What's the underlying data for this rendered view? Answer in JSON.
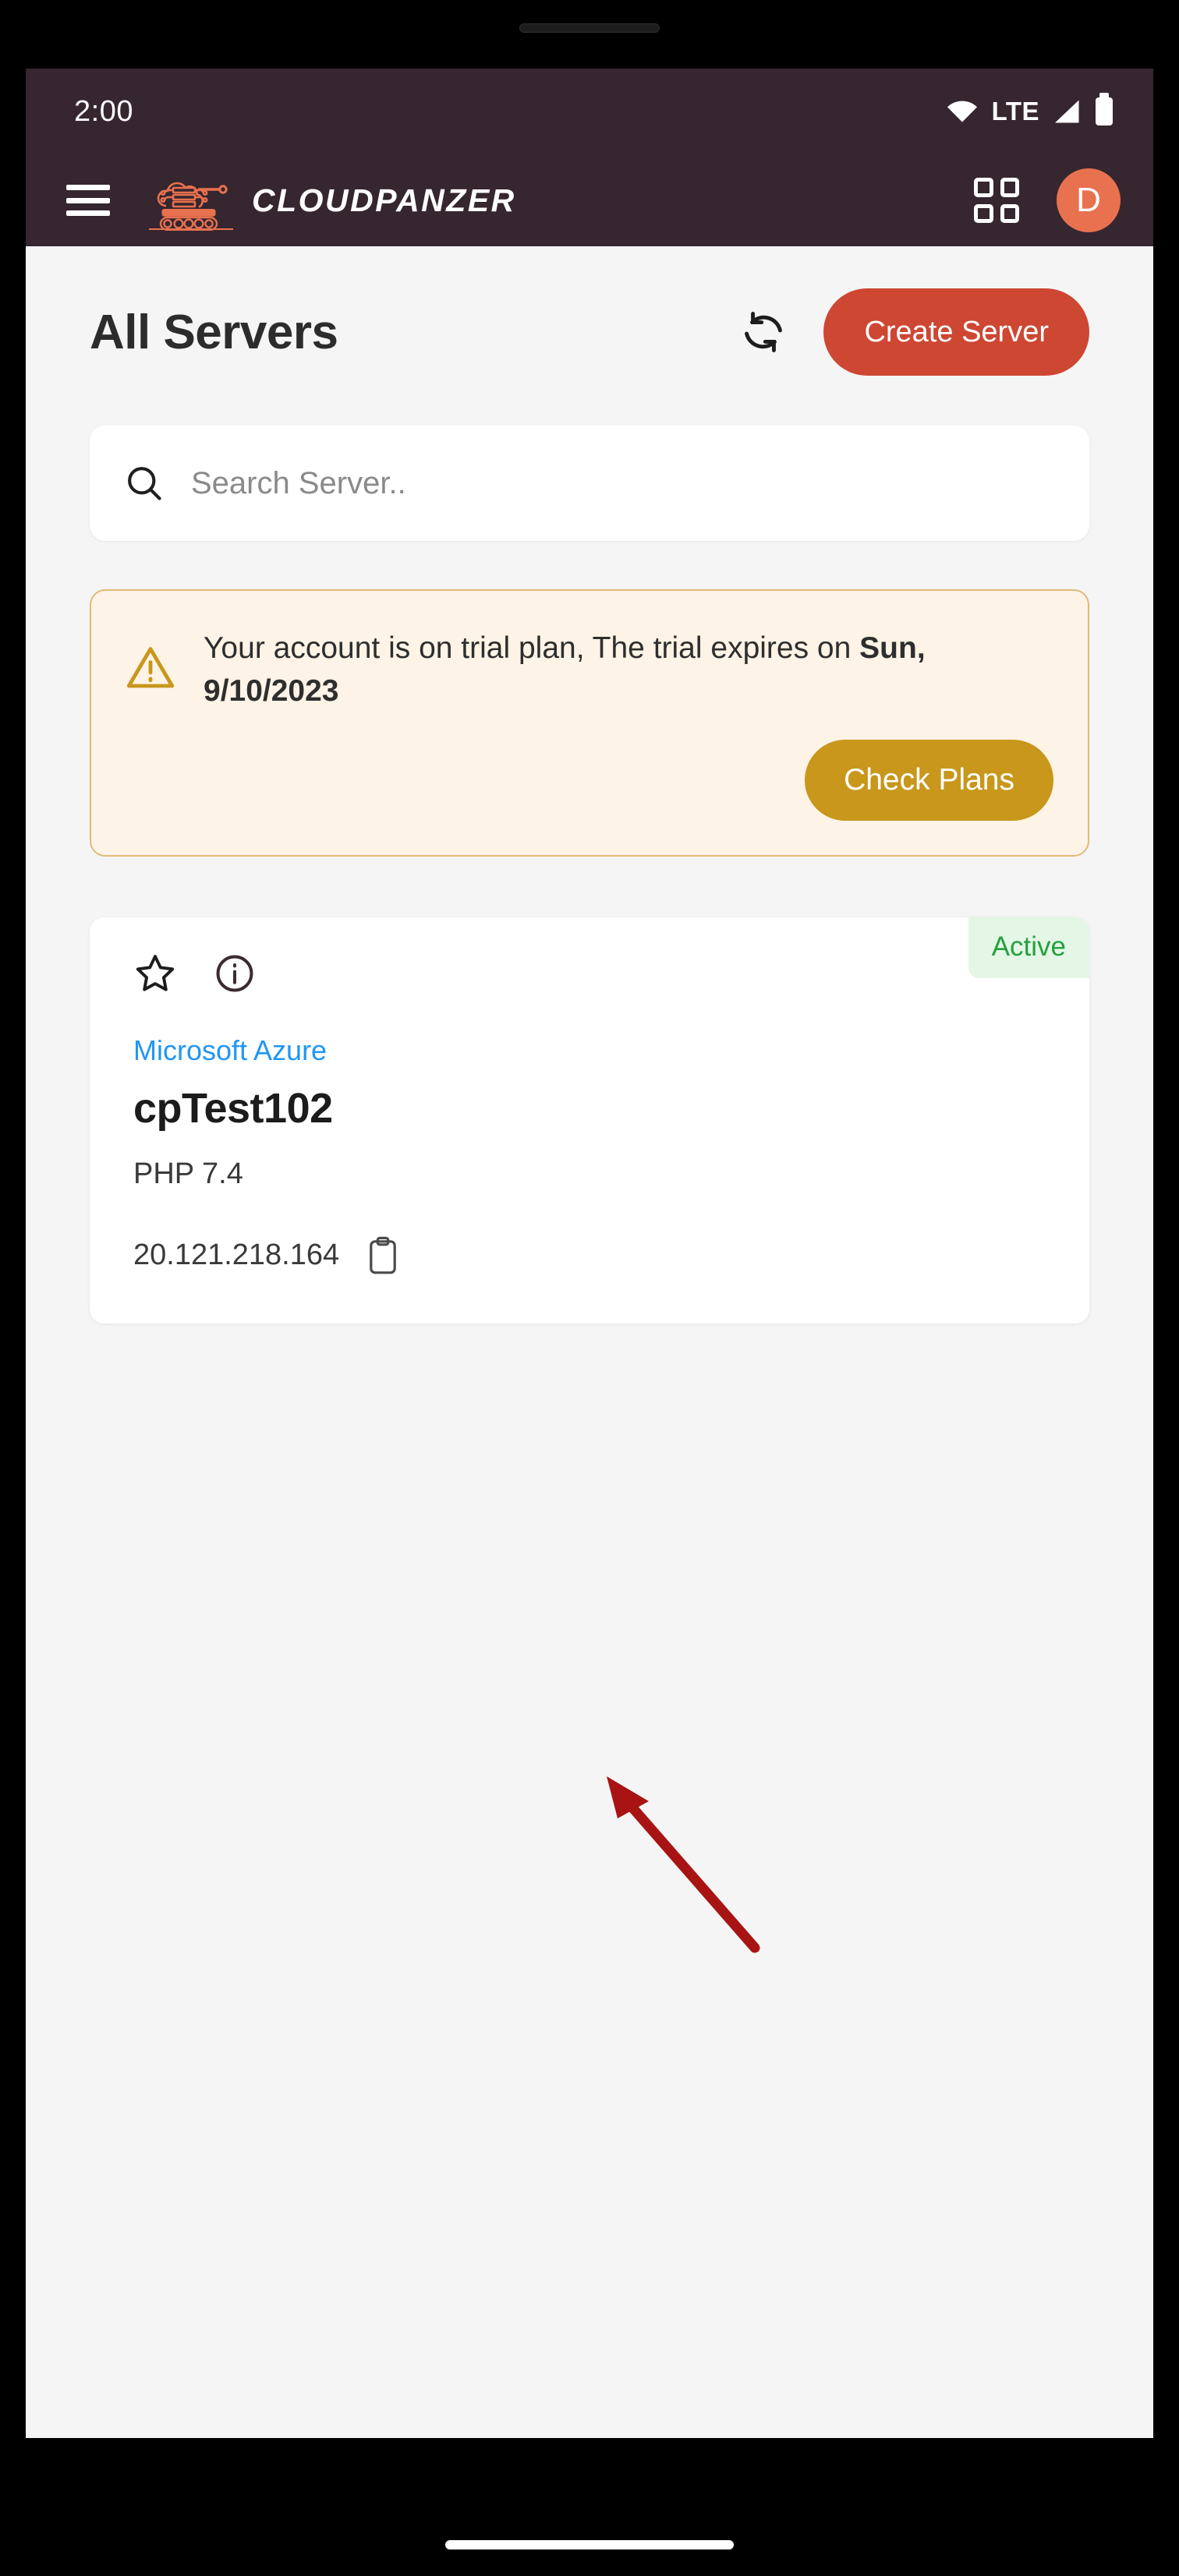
{
  "status_bar": {
    "time": "2:00",
    "network_label": "LTE",
    "icons": [
      "wifi-icon",
      "cellular-signal-icon",
      "battery-icon"
    ]
  },
  "app_bar": {
    "menu_icon": "hamburger-menu-icon",
    "logo_icon": "cloudpanzer-tank-logo-icon",
    "brand_name": "CLOUDPANZER",
    "grid_icon": "grid-apps-icon",
    "avatar_initial": "D"
  },
  "page": {
    "title": "All Servers",
    "refresh_icon": "refresh-icon",
    "create_button": "Create Server"
  },
  "search": {
    "icon": "search-icon",
    "value": "",
    "placeholder": "Search Server.."
  },
  "trial_banner": {
    "warning_icon": "warning-triangle-icon",
    "message": "Your account is on trial plan, The trial expires on",
    "expiry_date": "Sun, 9/10/2023",
    "cta_label": "Check Plans"
  },
  "server_card": {
    "status": "Active",
    "favorite_icon": "star-outline-icon",
    "info_icon": "info-circle-icon",
    "provider": "Microsoft Azure",
    "name": "cpTest102",
    "php_version": "PHP 7.4",
    "ip_address": "20.121.218.164",
    "copy_icon": "clipboard-copy-icon"
  },
  "colors": {
    "app_bar_bg": "#36262f",
    "brand_orange": "#e8714f",
    "primary_button": "#cd4733",
    "trial_bg": "#fdf3e6",
    "trial_border": "#e3b977",
    "trial_button": "#c8971b",
    "link_blue": "#2196f3",
    "status_green": "#27a03f",
    "status_green_bg": "#e4f6e6",
    "page_bg": "#f5f5f5",
    "annotation_arrow": "#a81414"
  }
}
